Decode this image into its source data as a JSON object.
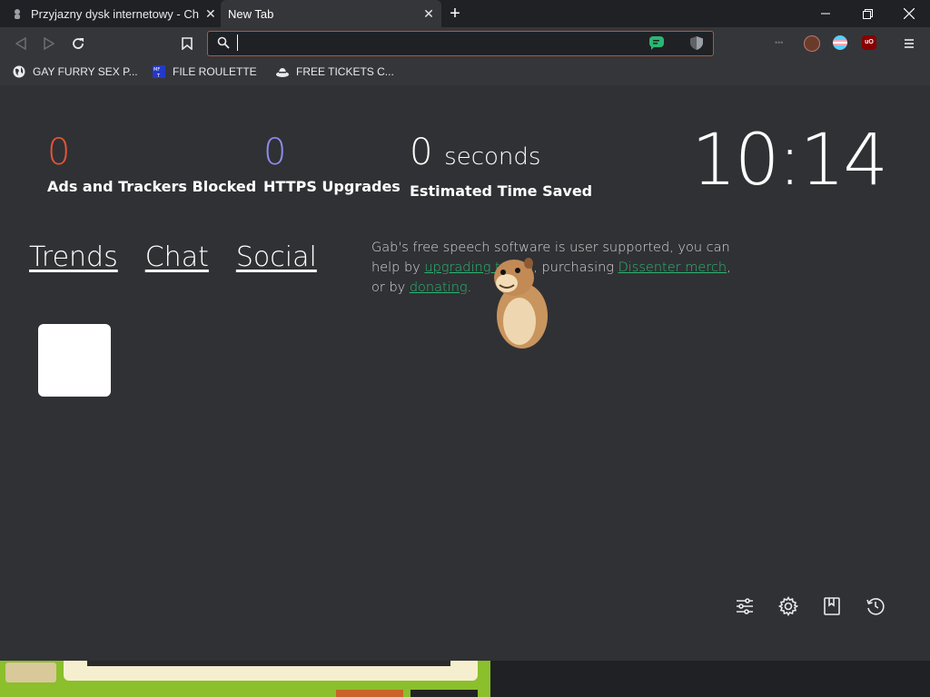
{
  "tabs": [
    {
      "title": "Przyjazny dysk internetowy - Ch",
      "active": false
    },
    {
      "title": "New Tab",
      "active": true
    }
  ],
  "window_controls": [
    "minimize-icon",
    "restore-icon",
    "close-icon"
  ],
  "address_bar": {
    "value": "",
    "placeholder": ""
  },
  "bookmarks": [
    {
      "label": "GAY FURRY SEX P...",
      "icon": "globe-icon"
    },
    {
      "label": "FILE ROULETTE",
      "icon": "mft-icon"
    },
    {
      "label": "FREE TICKETS C...",
      "icon": "hat-icon"
    }
  ],
  "stats": {
    "ads": {
      "value": "0",
      "label": "Ads and Trackers Blocked",
      "color": "#e8533a"
    },
    "https": {
      "value": "0",
      "label": "HTTPS Upgrades",
      "color": "#8f8cf0"
    },
    "time": {
      "value": "0",
      "unit": "seconds",
      "label": "Estimated Time Saved",
      "color": "#ffffff"
    }
  },
  "clock": "10:14",
  "nav_links": [
    "Trends",
    "Chat",
    "Social"
  ],
  "promo": {
    "t1": "Gab's free speech software is user supported, you can help by ",
    "link1": "upgrading to Pro",
    "t2": ", purchasing ",
    "link2": "Dissenter merch",
    "t3": ", or by ",
    "link3": "donating",
    "t4": "."
  },
  "bottom_icons": [
    "customize-icon",
    "settings-icon",
    "bookmarks-icon",
    "history-icon"
  ],
  "colors": {
    "accent_green": "#2bb673",
    "content_bg": "#303134",
    "omnibox_border": "#b4563c"
  }
}
